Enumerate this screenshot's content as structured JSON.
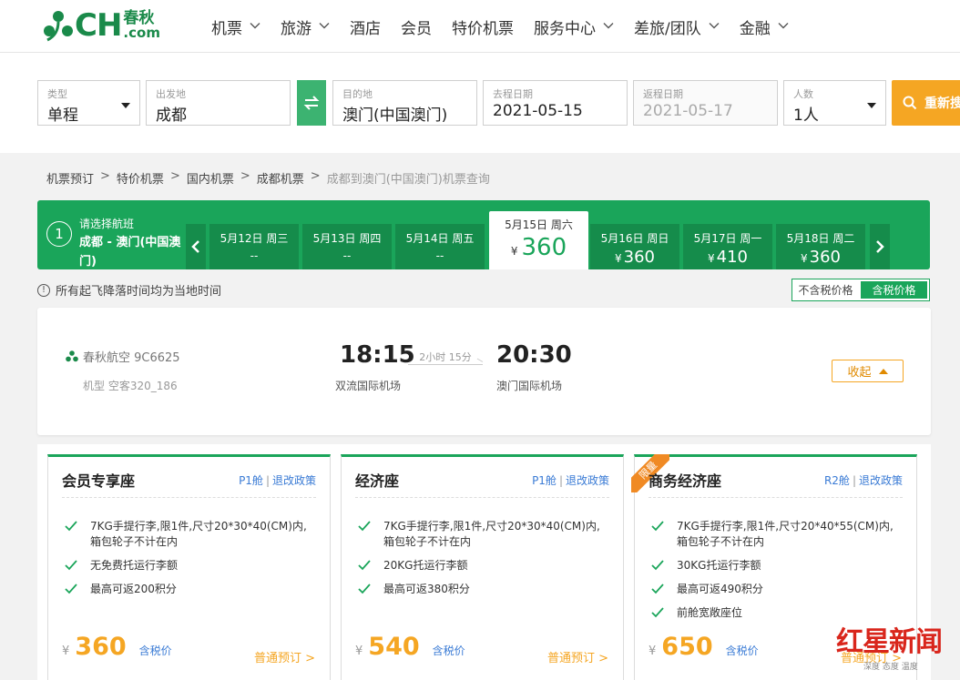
{
  "header": {
    "logo_ch": "CH",
    "logo_cn": "春秋",
    "logo_com": ".com",
    "nav": [
      {
        "label": "机票",
        "dropdown": true
      },
      {
        "label": "旅游",
        "dropdown": true
      },
      {
        "label": "酒店",
        "dropdown": false
      },
      {
        "label": "会员",
        "dropdown": false
      },
      {
        "label": "特价机票",
        "dropdown": false
      },
      {
        "label": "服务中心",
        "dropdown": true
      },
      {
        "label": "差旅/团队",
        "dropdown": true
      },
      {
        "label": "金融",
        "dropdown": true
      }
    ]
  },
  "search": {
    "type": {
      "label": "类型",
      "value": "单程"
    },
    "from": {
      "label": "出发地",
      "value": "成都"
    },
    "to": {
      "label": "目的地",
      "value": "澳门(中国澳门)"
    },
    "depart": {
      "label": "去程日期",
      "value": "2021-05-15"
    },
    "return": {
      "label": "返程日期",
      "value": "2021-05-17"
    },
    "people": {
      "label": "人数",
      "value": "1人"
    },
    "button": "重新搜索"
  },
  "breadcrumb": [
    "机票预订",
    "特价机票",
    "国内机票",
    "成都机票",
    "成都到澳门(中国澳门)机票查询"
  ],
  "datebar": {
    "step": "1",
    "title": "请选择航班",
    "route": "成都 - 澳门(中国澳门)",
    "currency": "¥",
    "dates": [
      {
        "date": "5月12日 周三",
        "price": "--"
      },
      {
        "date": "5月13日 周四",
        "price": "--"
      },
      {
        "date": "5月14日 周五",
        "price": "--"
      },
      {
        "date": "5月15日 周六",
        "price": "360"
      },
      {
        "date": "5月16日 周日",
        "price": "360"
      },
      {
        "date": "5月17日 周一",
        "price": "410"
      },
      {
        "date": "5月18日 周二",
        "price": "360"
      }
    ]
  },
  "notice": "所有起飞降落时间均为当地时间",
  "tax_toggle": {
    "excl": "不含税价格",
    "incl": "含税价格"
  },
  "flight": {
    "airline": "春秋航空 9C6625",
    "aircraft": "机型 空客320_186",
    "dep_time": "18:15",
    "arr_time": "20:30",
    "dep_airport": "双流国际机场",
    "arr_airport": "澳门国际机场",
    "duration": "2小时 15分",
    "collapse": "收起"
  },
  "cabins": [
    {
      "name": "会员专享座",
      "class": "P1舱",
      "policy": "退改政策",
      "features": [
        "7KG手提行李,限1件,尺寸20*30*40(CM)内,箱包轮子不计在内",
        "无免费托运行李额",
        "最高可返200积分"
      ],
      "currency": "¥",
      "price": "360",
      "tax": "含税价",
      "book": "普通预订 >"
    },
    {
      "name": "经济座",
      "class": "P1舱",
      "policy": "退改政策",
      "features": [
        "7KG手提行李,限1件,尺寸20*30*40(CM)内,箱包轮子不计在内",
        "20KG托运行李额",
        "最高可返380积分"
      ],
      "currency": "¥",
      "price": "540",
      "tax": "含税价",
      "book": "普通预订 >"
    },
    {
      "name": "商务经济座",
      "badge": "限量",
      "class": "R2舱",
      "policy": "退改政策",
      "features": [
        "7KG手提行李,限1件,尺寸20*40*55(CM)内,箱包轮子不计在内",
        "30KG托运行李额",
        "最高可返490积分",
        "前舱宽敞座位"
      ],
      "currency": "¥",
      "price": "650",
      "tax": "含税价",
      "book": "普通预订 >"
    }
  ],
  "watermark": {
    "main": "红星新闻",
    "sub": "深度 态度 温度"
  },
  "colors": {
    "brand_green": "#1aa55a",
    "accent_orange": "#f5a623",
    "link_blue": "#3a7bd5"
  }
}
